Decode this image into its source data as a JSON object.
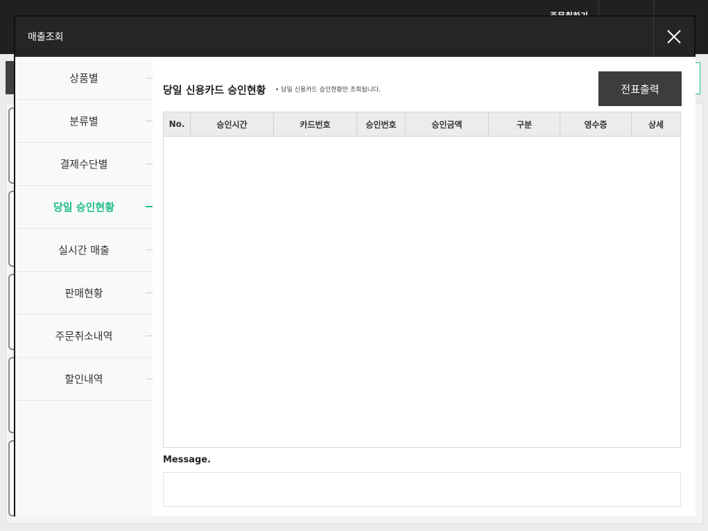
{
  "background": {
    "header_title": "주문취하기"
  },
  "modal": {
    "title": "매출조회",
    "close_icon": "close-icon"
  },
  "sidebar": {
    "items": [
      {
        "label": "상품별",
        "active": false
      },
      {
        "label": "분류별",
        "active": false
      },
      {
        "label": "결제수단별",
        "active": false
      },
      {
        "label": "당일 승인현황",
        "active": true
      },
      {
        "label": "실시간 매출",
        "active": false
      },
      {
        "label": "판매현황",
        "active": false
      },
      {
        "label": "주문취소내역",
        "active": false
      },
      {
        "label": "할인내역",
        "active": false
      }
    ]
  },
  "main": {
    "title": "당일 신용카드 승인현황",
    "description": "• 당일 신용카드 승인현황만 조회됩니다.",
    "print_button": "전표출력",
    "table": {
      "columns": [
        "No.",
        "승인시간",
        "카드번호",
        "승인번호",
        "승인금액",
        "구분",
        "영수증",
        "상세"
      ],
      "rows": []
    },
    "message_label": "Message.",
    "message_value": ""
  },
  "colors": {
    "accent": "#1fbf82",
    "header_bg": "#252525",
    "button_bg": "#3d3d3d"
  }
}
